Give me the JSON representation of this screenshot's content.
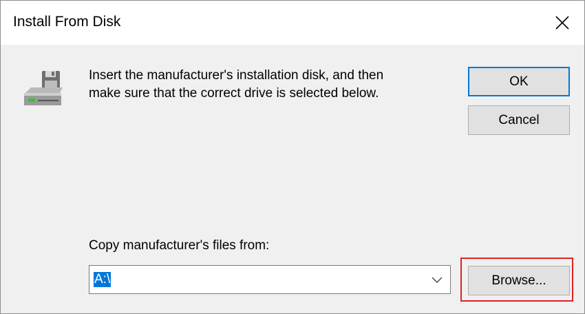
{
  "window": {
    "title": "Install From Disk",
    "close_icon": "close-icon"
  },
  "main": {
    "icon": "floppy-drive-icon",
    "message_line1": "Insert the manufacturer's installation disk, and then",
    "message_line2": "make sure that the correct drive is selected below."
  },
  "buttons": {
    "ok_label": "OK",
    "cancel_label": "Cancel",
    "browse_label": "Browse..."
  },
  "copy_from": {
    "label": "Copy manufacturer's files from:",
    "value": "A:\\",
    "dropdown_icon": "chevron-down-icon"
  },
  "colors": {
    "accent": "#0078d7",
    "highlight": "#e02020",
    "dialog_bg": "#f0f0f0"
  }
}
